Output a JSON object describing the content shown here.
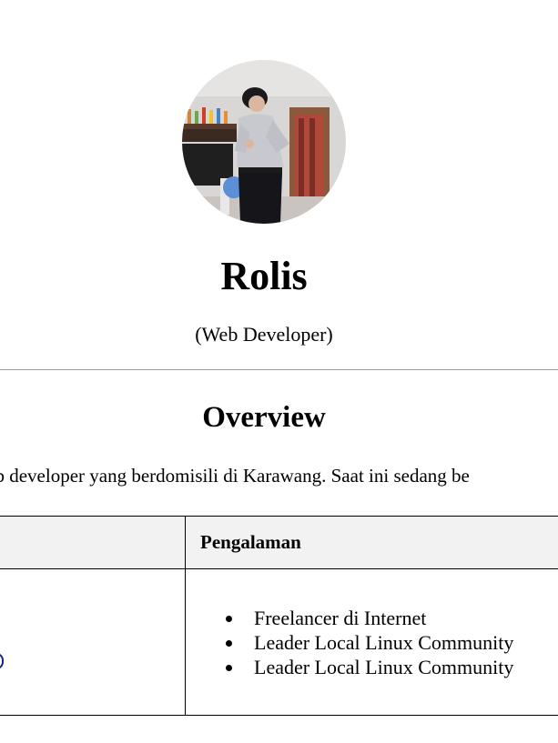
{
  "profile": {
    "name": "Rolis",
    "role": "(Web Developer)",
    "avatar_icon": "profile-photo"
  },
  "overview": {
    "title": "Overview",
    "text": "web developer yang berdomisili di Karawang. Saat ini sedang be"
  },
  "table": {
    "header_experience": "Pengalaman",
    "experience_items": [
      "Freelancer di Internet",
      "Leader Local Linux Community",
      "Leader Local Linux Community"
    ]
  },
  "colors": {
    "rule": "#9a9a9a",
    "table_header_bg": "#f2f2f2",
    "text": "#000000"
  }
}
